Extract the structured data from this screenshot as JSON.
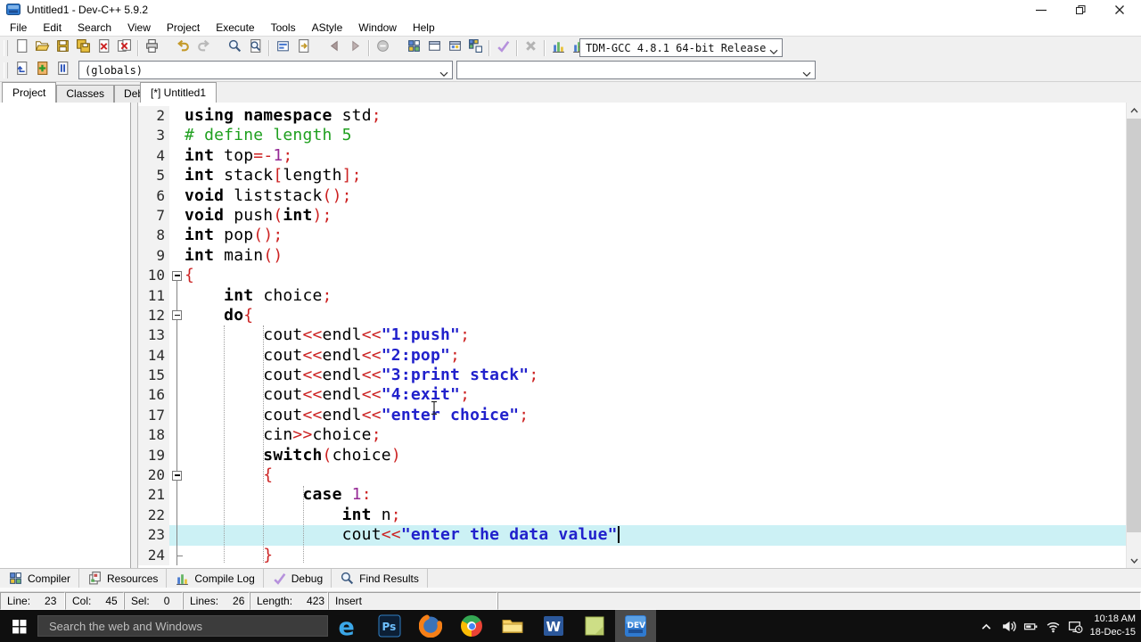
{
  "titlebar": {
    "title": "Untitled1 - Dev-C++ 5.9.2"
  },
  "menubar": {
    "items": [
      "File",
      "Edit",
      "Search",
      "View",
      "Project",
      "Execute",
      "Tools",
      "AStyle",
      "Window",
      "Help"
    ]
  },
  "toolbar_main": {
    "buttons": [
      "new-file-icon",
      "open-file-icon",
      "save-icon",
      "save-all-icon",
      "close-file-icon",
      "close-all-icon",
      "|",
      "print-icon",
      "~",
      "undo-icon",
      "redo-icon",
      "~",
      "find-icon",
      "find-in-files-icon",
      "|",
      "replace-icon",
      "goto-line-icon",
      "~",
      "back-icon",
      "forward-icon",
      "|",
      "breakpoint-icon",
      "~",
      "compile-icon",
      "run-icon",
      "compile-run-icon",
      "rebuild-icon",
      "|",
      "syntax-check-icon",
      "|",
      "abort-icon",
      "|",
      "profile-icon",
      "profile-del-icon"
    ],
    "compiler_select": "TDM-GCC 4.8.1 64-bit Release"
  },
  "browser_bar": {
    "buttons": [
      "goto-declaration-icon",
      "add-member-icon",
      "class-browser-icon"
    ],
    "scope_select": "(globals)",
    "member_select": ""
  },
  "left_panel": {
    "tabs": [
      "Project",
      "Classes",
      "Debug"
    ],
    "active_tab": "Project"
  },
  "editor": {
    "tab": "[*] Untitled1",
    "current_line": 23,
    "colors": {
      "symbol": "#cc2222",
      "string": "#2121cc",
      "number": "#952995",
      "preprocessor": "#1fa01f",
      "current_line": "#ccf1f5"
    },
    "lines": [
      {
        "n": 2,
        "fold": "",
        "tokens": [
          [
            "k",
            "using"
          ],
          [
            "p",
            " "
          ],
          [
            "k",
            "namespace"
          ],
          [
            "p",
            " std"
          ],
          [
            "s",
            ";"
          ]
        ]
      },
      {
        "n": 3,
        "fold": "",
        "tokens": [
          [
            "d",
            "# define length 5"
          ]
        ]
      },
      {
        "n": 4,
        "fold": "",
        "tokens": [
          [
            "k",
            "int"
          ],
          [
            "p",
            " top"
          ],
          [
            "s",
            "=-"
          ],
          [
            "n",
            "1"
          ],
          [
            "s",
            ";"
          ]
        ]
      },
      {
        "n": 5,
        "fold": "",
        "tokens": [
          [
            "k",
            "int"
          ],
          [
            "p",
            " stack"
          ],
          [
            "s",
            "["
          ],
          [
            "p",
            "length"
          ],
          [
            "s",
            "];"
          ]
        ]
      },
      {
        "n": 6,
        "fold": "",
        "tokens": [
          [
            "k",
            "void"
          ],
          [
            "p",
            " liststack"
          ],
          [
            "s",
            "();"
          ]
        ]
      },
      {
        "n": 7,
        "fold": "",
        "tokens": [
          [
            "k",
            "void"
          ],
          [
            "p",
            " push"
          ],
          [
            "s",
            "("
          ],
          [
            "k",
            "int"
          ],
          [
            "s",
            ");"
          ]
        ]
      },
      {
        "n": 8,
        "fold": "",
        "tokens": [
          [
            "k",
            "int"
          ],
          [
            "p",
            " pop"
          ],
          [
            "s",
            "();"
          ]
        ]
      },
      {
        "n": 9,
        "fold": "",
        "tokens": [
          [
            "k",
            "int"
          ],
          [
            "p",
            " main"
          ],
          [
            "s",
            "()"
          ]
        ]
      },
      {
        "n": 10,
        "fold": "open-first",
        "tokens": [
          [
            "s",
            "{"
          ]
        ]
      },
      {
        "n": 11,
        "fold": "line",
        "tokens": [
          [
            "p",
            "    "
          ],
          [
            "k",
            "int"
          ],
          [
            "p",
            " choice"
          ],
          [
            "s",
            ";"
          ]
        ]
      },
      {
        "n": 12,
        "fold": "open",
        "tokens": [
          [
            "p",
            "    "
          ],
          [
            "k",
            "do"
          ],
          [
            "s",
            "{"
          ]
        ]
      },
      {
        "n": 13,
        "fold": "line",
        "tokens": [
          [
            "p",
            "        cout"
          ],
          [
            "s",
            "<<"
          ],
          [
            "p",
            "endl"
          ],
          [
            "s",
            "<<"
          ],
          [
            "t",
            "\"1:push\""
          ],
          [
            "s",
            ";"
          ]
        ]
      },
      {
        "n": 14,
        "fold": "line",
        "tokens": [
          [
            "p",
            "        cout"
          ],
          [
            "s",
            "<<"
          ],
          [
            "p",
            "endl"
          ],
          [
            "s",
            "<<"
          ],
          [
            "t",
            "\"2:pop\""
          ],
          [
            "s",
            ";"
          ]
        ]
      },
      {
        "n": 15,
        "fold": "line",
        "tokens": [
          [
            "p",
            "        cout"
          ],
          [
            "s",
            "<<"
          ],
          [
            "p",
            "endl"
          ],
          [
            "s",
            "<<"
          ],
          [
            "t",
            "\"3:print stack\""
          ],
          [
            "s",
            ";"
          ]
        ]
      },
      {
        "n": 16,
        "fold": "line",
        "tokens": [
          [
            "p",
            "        cout"
          ],
          [
            "s",
            "<<"
          ],
          [
            "p",
            "endl"
          ],
          [
            "s",
            "<<"
          ],
          [
            "t",
            "\"4:exit\""
          ],
          [
            "s",
            ";"
          ]
        ]
      },
      {
        "n": 17,
        "fold": "line",
        "tokens": [
          [
            "p",
            "        cout"
          ],
          [
            "s",
            "<<"
          ],
          [
            "p",
            "endl"
          ],
          [
            "s",
            "<<"
          ],
          [
            "t",
            "\"enter choice\""
          ],
          [
            "s",
            ";"
          ]
        ]
      },
      {
        "n": 18,
        "fold": "line",
        "tokens": [
          [
            "p",
            "        cin"
          ],
          [
            "s",
            ">>"
          ],
          [
            "p",
            "choice"
          ],
          [
            "s",
            ";"
          ]
        ]
      },
      {
        "n": 19,
        "fold": "line",
        "tokens": [
          [
            "p",
            "        "
          ],
          [
            "k",
            "switch"
          ],
          [
            "s",
            "("
          ],
          [
            "p",
            "choice"
          ],
          [
            "s",
            ")"
          ]
        ]
      },
      {
        "n": 20,
        "fold": "open",
        "tokens": [
          [
            "p",
            "        "
          ],
          [
            "s",
            "{"
          ]
        ]
      },
      {
        "n": 21,
        "fold": "line",
        "tokens": [
          [
            "p",
            "            "
          ],
          [
            "k",
            "case"
          ],
          [
            "p",
            " "
          ],
          [
            "n",
            "1"
          ],
          [
            "s",
            ":"
          ]
        ]
      },
      {
        "n": 22,
        "fold": "line",
        "tokens": [
          [
            "p",
            "                "
          ],
          [
            "k",
            "int"
          ],
          [
            "p",
            " n"
          ],
          [
            "s",
            ";"
          ]
        ]
      },
      {
        "n": 23,
        "fold": "line",
        "caret": true,
        "tokens": [
          [
            "p",
            "                cout"
          ],
          [
            "s",
            "<<"
          ],
          [
            "t",
            "\"enter the data value\""
          ]
        ]
      },
      {
        "n": 24,
        "fold": "end",
        "tokens": [
          [
            "p",
            "        "
          ],
          [
            "s",
            "}"
          ]
        ]
      }
    ]
  },
  "bottom_tabs": [
    {
      "icon": "compiler-grid-icon",
      "label": "Compiler"
    },
    {
      "icon": "resources-icon",
      "label": "Resources"
    },
    {
      "icon": "compile-log-icon",
      "label": "Compile Log"
    },
    {
      "icon": "debug-check-icon",
      "label": "Debug"
    },
    {
      "icon": "find-results-icon",
      "label": "Find Results"
    }
  ],
  "statusbar": {
    "fields": [
      {
        "label": "Line:",
        "value": "23"
      },
      {
        "label": "Col:",
        "value": "45"
      },
      {
        "label": "Sel:",
        "value": "0"
      },
      {
        "label": "Lines:",
        "value": "26"
      },
      {
        "label": "Length:",
        "value": "423"
      },
      {
        "label": "Insert",
        "value": ""
      }
    ]
  },
  "taskbar": {
    "search_placeholder": "Search the web and Windows",
    "apps": [
      {
        "name": "edge",
        "icon": "edge-icon"
      },
      {
        "name": "photoshop",
        "icon": "photoshop-icon"
      },
      {
        "name": "firefox",
        "icon": "firefox-icon"
      },
      {
        "name": "chrome",
        "icon": "chrome-icon"
      },
      {
        "name": "file-explorer",
        "icon": "explorer-icon"
      },
      {
        "name": "word",
        "icon": "word-icon"
      },
      {
        "name": "notes",
        "icon": "green-app-icon"
      },
      {
        "name": "dev-cpp",
        "icon": "devcpp-icon",
        "active": true
      }
    ],
    "tray_icons": [
      "chevron-up-icon",
      "volume-icon",
      "battery-icon",
      "wifi-icon",
      "monitor-clock-icon"
    ],
    "clock": {
      "time": "10:18 AM",
      "date": "18-Dec-15"
    }
  }
}
